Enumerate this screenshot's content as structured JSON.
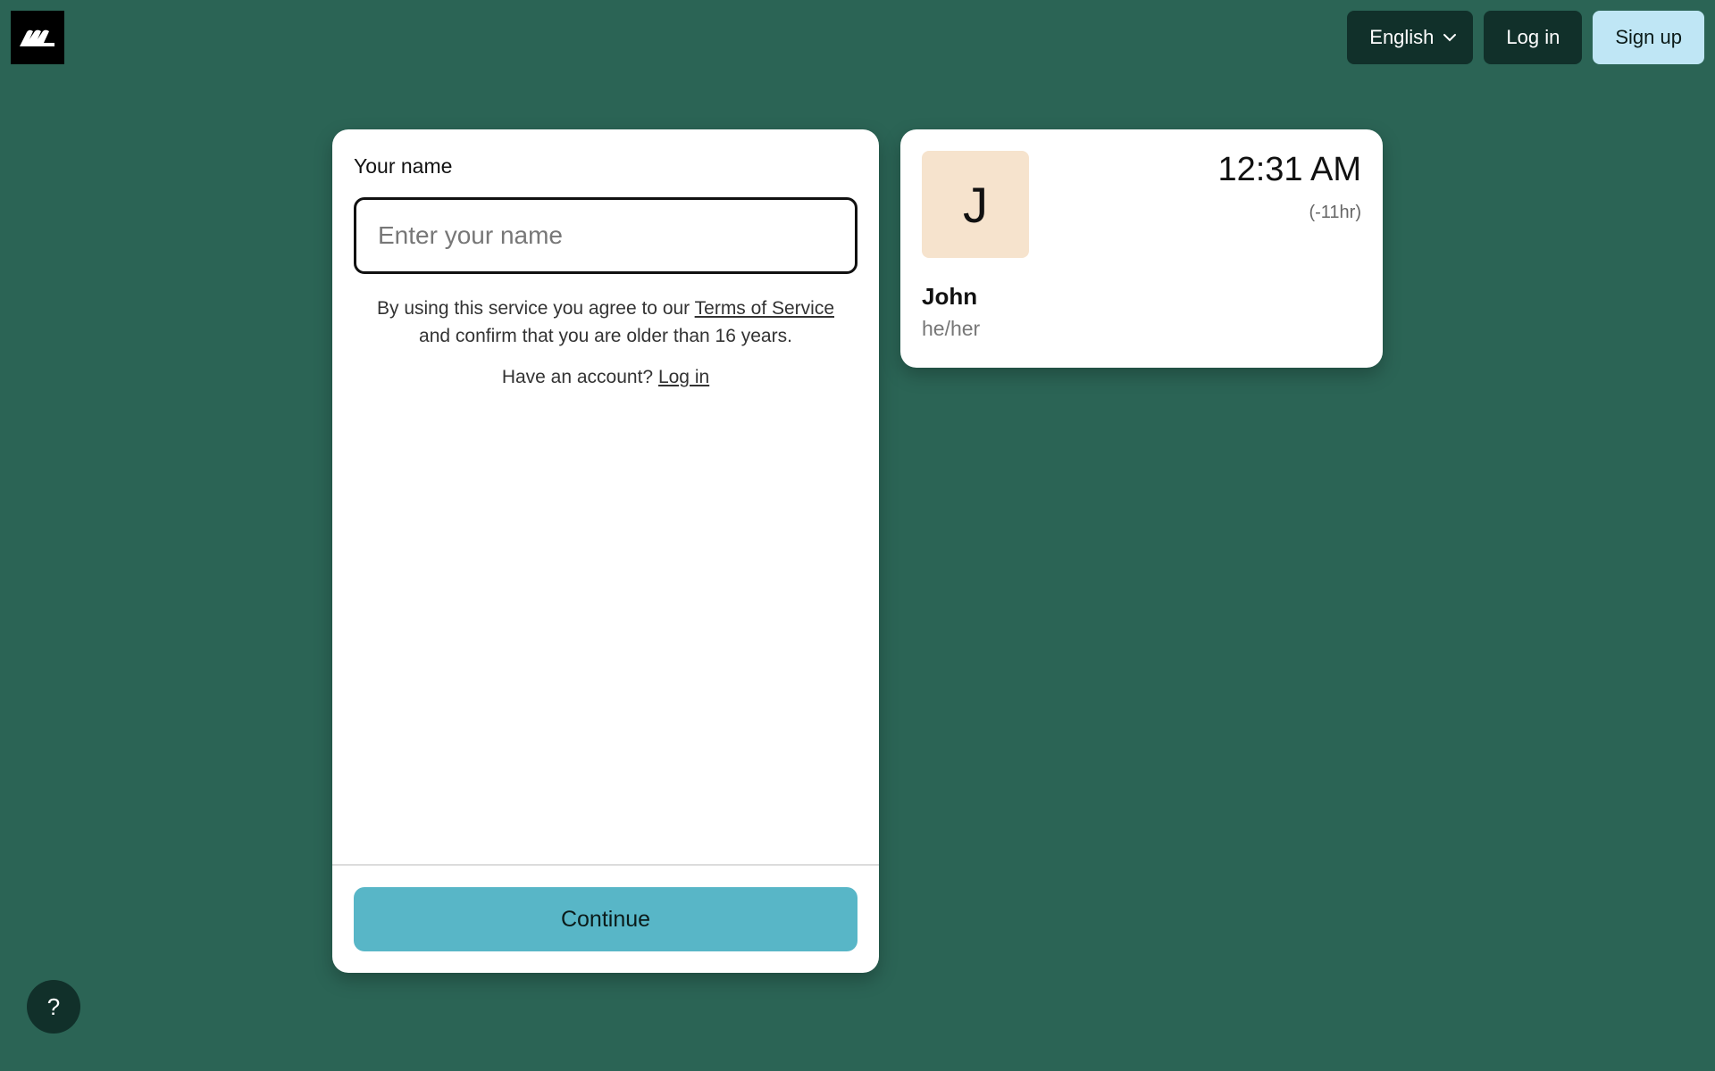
{
  "header": {
    "language_label": "English",
    "login_label": "Log in",
    "signup_label": "Sign up"
  },
  "form": {
    "name_label": "Your name",
    "name_placeholder": "Enter your name",
    "name_value": "",
    "terms_prefix": "By using this service you agree to our",
    "terms_link": "Terms of Service",
    "terms_suffix": "and confirm that you are older than 16 years.",
    "account_prompt": "Have an account?",
    "account_link": "Log in",
    "continue_label": "Continue"
  },
  "profile": {
    "avatar_initial": "J",
    "time": "12:31 AM",
    "offset": "(-11hr)",
    "name": "John",
    "pronouns": "he/her"
  },
  "help": {
    "label": "?"
  },
  "colors": {
    "background": "#2b6455",
    "dark_button": "#11302a",
    "signup_button": "#bfe6f5",
    "continue_button": "#58b6c7",
    "avatar_bg": "#f6e3cd"
  },
  "icons": {
    "logo": "brand-logo-icon",
    "language_chevron": "chevron-down-icon"
  }
}
